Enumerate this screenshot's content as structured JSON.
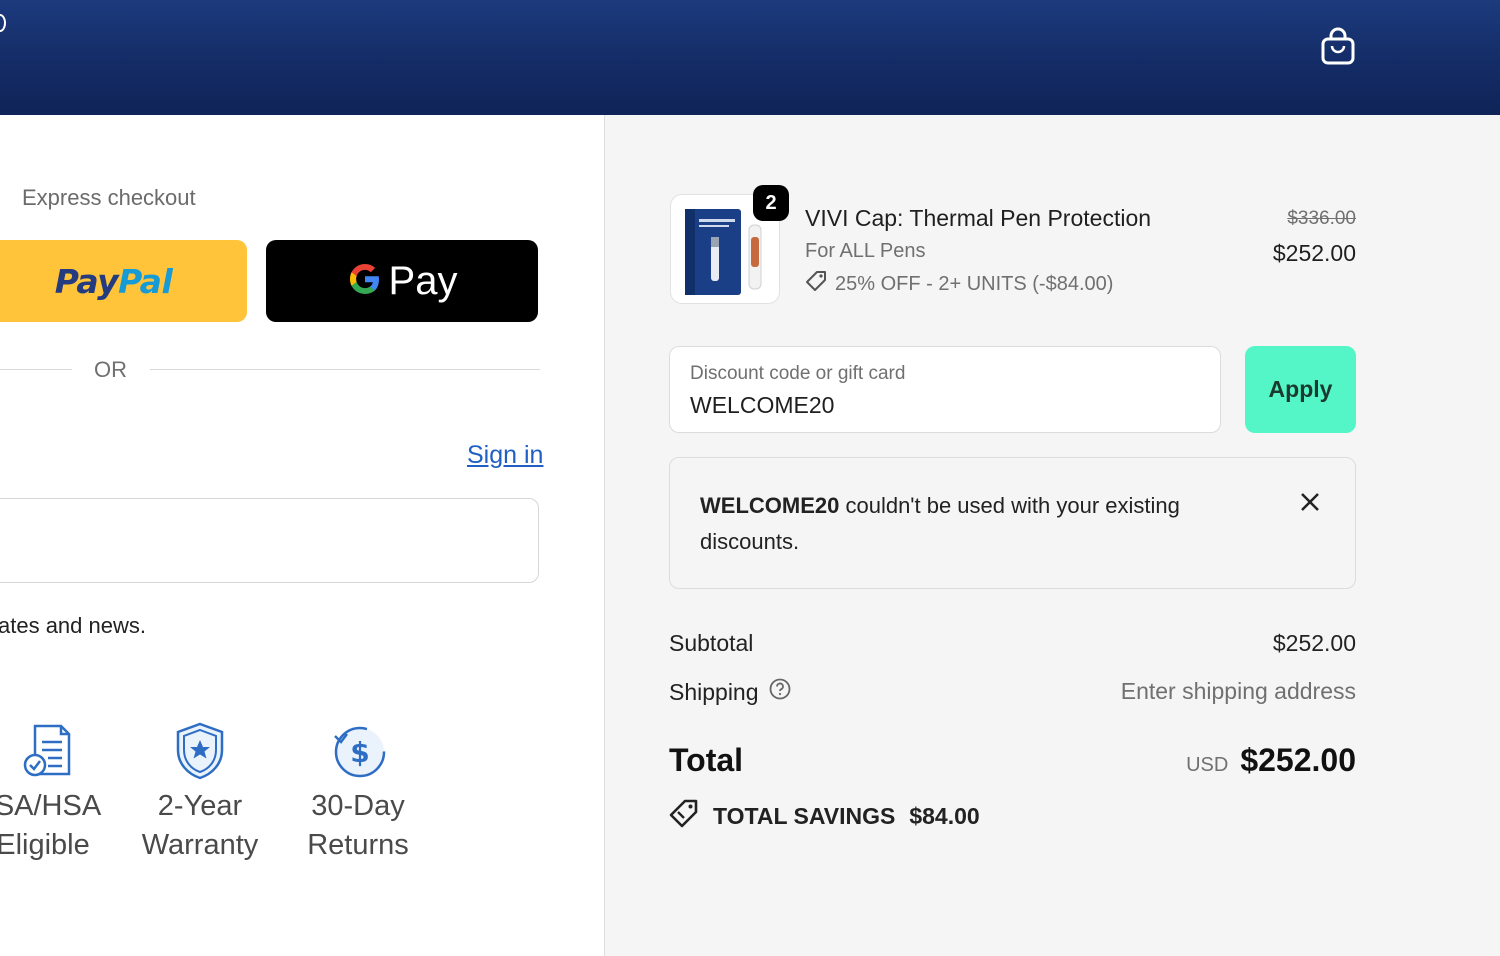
{
  "checkout": {
    "express_label": "Express checkout",
    "paypal_label_1": "Pay",
    "paypal_label_2": "Pal",
    "gpay_label": "Pay",
    "or_label": "OR",
    "signin_label": "Sign in",
    "news_text": "ates and news."
  },
  "badges": [
    {
      "line1": "SA/HSA",
      "line2": "Eligible",
      "icon": "document-check-icon"
    },
    {
      "line1": "2-Year",
      "line2": "Warranty",
      "icon": "shield-star-icon"
    },
    {
      "line1": "30-Day",
      "line2": "Returns",
      "icon": "dollar-refresh-icon"
    }
  ],
  "cart": {
    "item": {
      "quantity": "2",
      "title": "VIVI Cap: Thermal Pen Protection",
      "variant": "For ALL Pens",
      "discount": "25% OFF - 2+ UNITS (-$84.00)",
      "price_original": "$336.00",
      "price_final": "$252.00"
    },
    "discount_field": {
      "placeholder": "Discount code or gift card",
      "value": "WELCOME20",
      "apply_label": "Apply"
    },
    "notice": {
      "code": "WELCOME20",
      "message": " couldn't be used with your existing discounts."
    },
    "subtotal_label": "Subtotal",
    "subtotal_value": "$252.00",
    "shipping_label": "Shipping",
    "shipping_value": "Enter shipping address",
    "total_label": "Total",
    "total_currency": "USD",
    "total_value": "$252.00",
    "savings_label": "TOTAL SAVINGS",
    "savings_value": "$84.00"
  },
  "colors": {
    "header": "#142c66",
    "paypal": "#ffc439",
    "apply": "#54f5c6",
    "link": "#1f5fc4"
  }
}
